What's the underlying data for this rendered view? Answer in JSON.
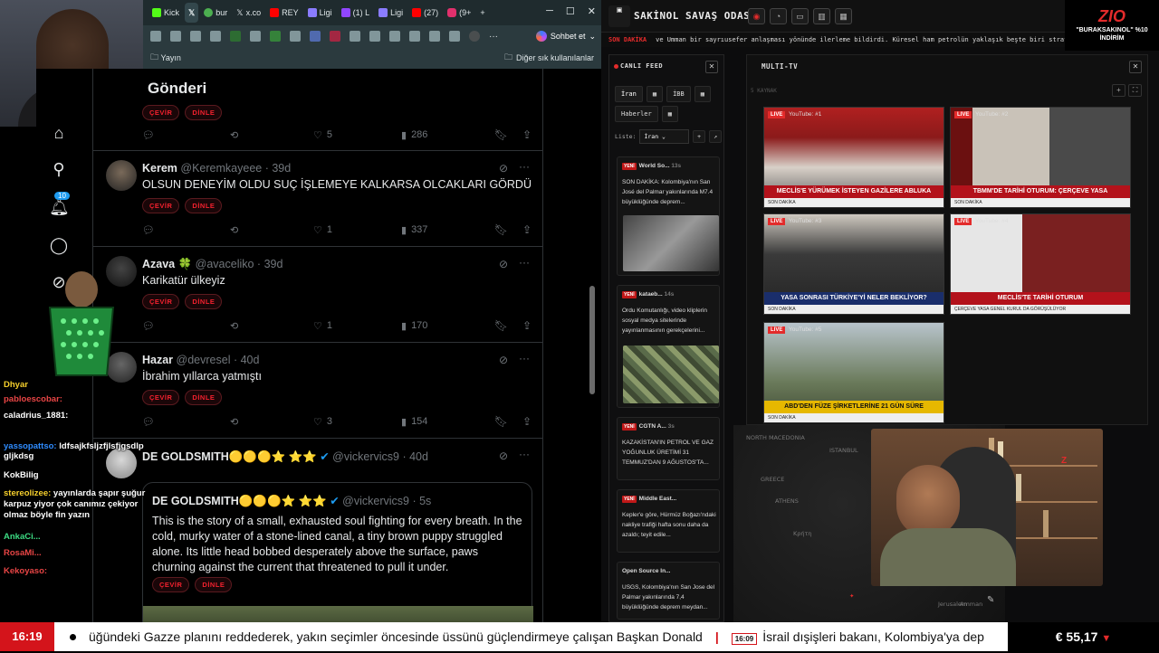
{
  "browser": {
    "tabs": [
      "Kick",
      "X",
      "bur",
      "x.co",
      "REY",
      "Ligi",
      "(1) L",
      "Ligi",
      "(27)",
      "(9+"
    ],
    "sohbet_label": "Sohbet et",
    "bookmark_left": "Yayın",
    "bookmark_right": "Diğer sık kullanılanlar"
  },
  "x": {
    "feed_title": "Gönderi",
    "notif_count": "10",
    "translate_label": "ÇEVİR",
    "listen_label": "DİNLE",
    "tweets": [
      {
        "name": "",
        "handle": "",
        "text": "",
        "replies": "",
        "likes": "5",
        "views": "286"
      },
      {
        "name": "Kerem",
        "handle": "@Keremkayeee · 39d",
        "text": "OLSUN DENEYİM OLDU SUÇ İŞLEMEYE KALKARSA OLCAKLARI GÖRDÜ",
        "likes": "1",
        "views": "337"
      },
      {
        "name": "Azava 🍀",
        "handle": "@avaceliko · 39d",
        "text": "Karikatür ülkeyiz",
        "likes": "1",
        "views": "170"
      },
      {
        "name": "Hazar",
        "handle": "@devresel · 40d",
        "text": "İbrahim yıllarca yatmıştı",
        "likes": "3",
        "views": "154"
      },
      {
        "name": "DE GOLDSMITH🟡🟡🟡⭐ ⭐⭐",
        "handle": "@vickervics9 · 40d"
      }
    ],
    "quote": {
      "name": "DE GOLDSMITH🟡🟡🟡⭐ ⭐⭐",
      "handle": "@vickervics9 · 5s",
      "text": "This is the story of a small, exhausted soul fighting for every breath. In the cold, murky water of a stone-lined canal, a tiny brown puppy struggled alone. Its little head bobbed desperately above the surface, paws churning against the current that threatened to pull it under."
    }
  },
  "chat": [
    {
      "user": "Dhyar",
      "msg": "",
      "color": "#f7d02c"
    },
    {
      "user": "pabloescobar:",
      "msg": "",
      "color": "#e84545"
    },
    {
      "user": "caladrius_1881:",
      "msg": "",
      "color": "#ffffff"
    },
    {
      "user": "yassopattso:",
      "msg": "ldfsajkfsljzfjlsfjgsdlp gljkdsg",
      "color": "#2f8cff"
    },
    {
      "user": "KokBilig",
      "msg": "",
      "color": "#ffffff"
    },
    {
      "user": "stereolizee:",
      "msg": "yayınlarda şapır şuğur karpuz yiyor çok canımız çekiyor olmaz böyle fin yazın",
      "color": "#f7d02c"
    },
    {
      "user": "AnkaCi...",
      "msg": "",
      "color": "#3ddc84"
    },
    {
      "user": "RosaMi...",
      "msg": "",
      "color": "#e84545"
    },
    {
      "user": "Kekoyaso:",
      "msg": "",
      "color": "#e84545"
    }
  ],
  "app": {
    "title": "SAKİNOL SAVAŞ ODASI",
    "ticker_label": "SON DAKİKA",
    "ticker_text": "ve Umman bir sayrıusefer anlaşması yönünde ilerleme bildirdi. Küresel ham petrolün yaklaşık beşte biri stratejik su yolund",
    "zio_brand": "ZIO",
    "zio_promo": "\"BURAKSAKINOL\" %10 İNDİRİM",
    "livefeed": {
      "title": "CANLI FEED",
      "tabs": [
        "İran",
        "İBB",
        "Haberler"
      ],
      "liste_label": "Liste:",
      "liste_value": "İran",
      "cards": [
        {
          "tag": "YENİ",
          "source": "World So...",
          "time": "13s",
          "text": "SON DAKİKA: Kolombiya'nın San José del Palmar yakınlarında M7.4 büyüklüğünde deprem..."
        },
        {
          "tag": "YENİ",
          "source": "kataeb...",
          "time": "14s",
          "text": "Ordu Komutanlığı, video kliplerin sosyal medya sitelerinde yayınlanmasının gerekçelerini..."
        },
        {
          "tag": "YENİ",
          "source": "CGTN A...",
          "time": "3s",
          "text": "KAZAKİSTAN'IN PETROL VE GAZ YOĞUNLUK ÜRETİMİ 31 TEMMUZ'DAN 9 AĞUSTOS'TA..."
        },
        {
          "tag": "YENİ",
          "source": "Middle East...",
          "time": "",
          "text": "Kepler'e göre, Hürmüz Boğazı'ndaki nakliye trafiği hafta sonu daha da azaldı; teyit edile..."
        },
        {
          "tag": "",
          "source": "Open Source In...",
          "time": "",
          "text": "USGS, Kolombiya'nın San Jose del Palmar yakınlarında 7,4 büyüklüğünde deprem meydan..."
        }
      ]
    },
    "multitv": {
      "title": "MULTI-TV",
      "subtitle": "5 KAYNAK",
      "live_label": "LIVE",
      "screens": [
        {
          "label": "YouTube: #1",
          "caption": "MECLİS'E YÜRÜMEK İSTEYEN GAZİLERE ABLUKA",
          "sub": "SON DAKİKA"
        },
        {
          "label": "YouTube: #2",
          "caption": "TBMM'DE TARİHİ OTURUM: ÇERÇEVE YASA",
          "sub": "SON DAKİKA"
        },
        {
          "label": "YouTube: #3",
          "caption": "YASA SONRASI TÜRKİYE'Yİ NELER BEKLİYOR?",
          "sub": "SON DAKİKA"
        },
        {
          "label": "YouTube: #4",
          "caption": "MECLİS'TE TARİHİ OTURUM",
          "sub": "ÇERÇEVE YASA GENEL KURUL DA GÖRÜŞÜLÜYOR"
        },
        {
          "label": "YouTube: #5",
          "caption": "ABD'DEN FÜZE ŞİRKETLERİNE 21 GÜN SÜRE",
          "sub": "SON DAKİKA"
        }
      ]
    },
    "map_labels": [
      "NORTH MACEDONIA",
      "ISTANBUL",
      "GREECE",
      "ATHENS",
      "Κρήτη",
      "Jerusalem",
      "Amman"
    ]
  },
  "bottom": {
    "clock": "16:19",
    "news1": "üğündeki Gazze planını reddederek, yakın seçimler öncesinde üssünü güçlendirmeye çalışan Başkan Donald",
    "time2": "16:09",
    "news2": "İsrail dışişleri bakanı, Kolombiya'ya dep",
    "euro": "€ 55,17",
    "euro_arrow": "▼"
  }
}
